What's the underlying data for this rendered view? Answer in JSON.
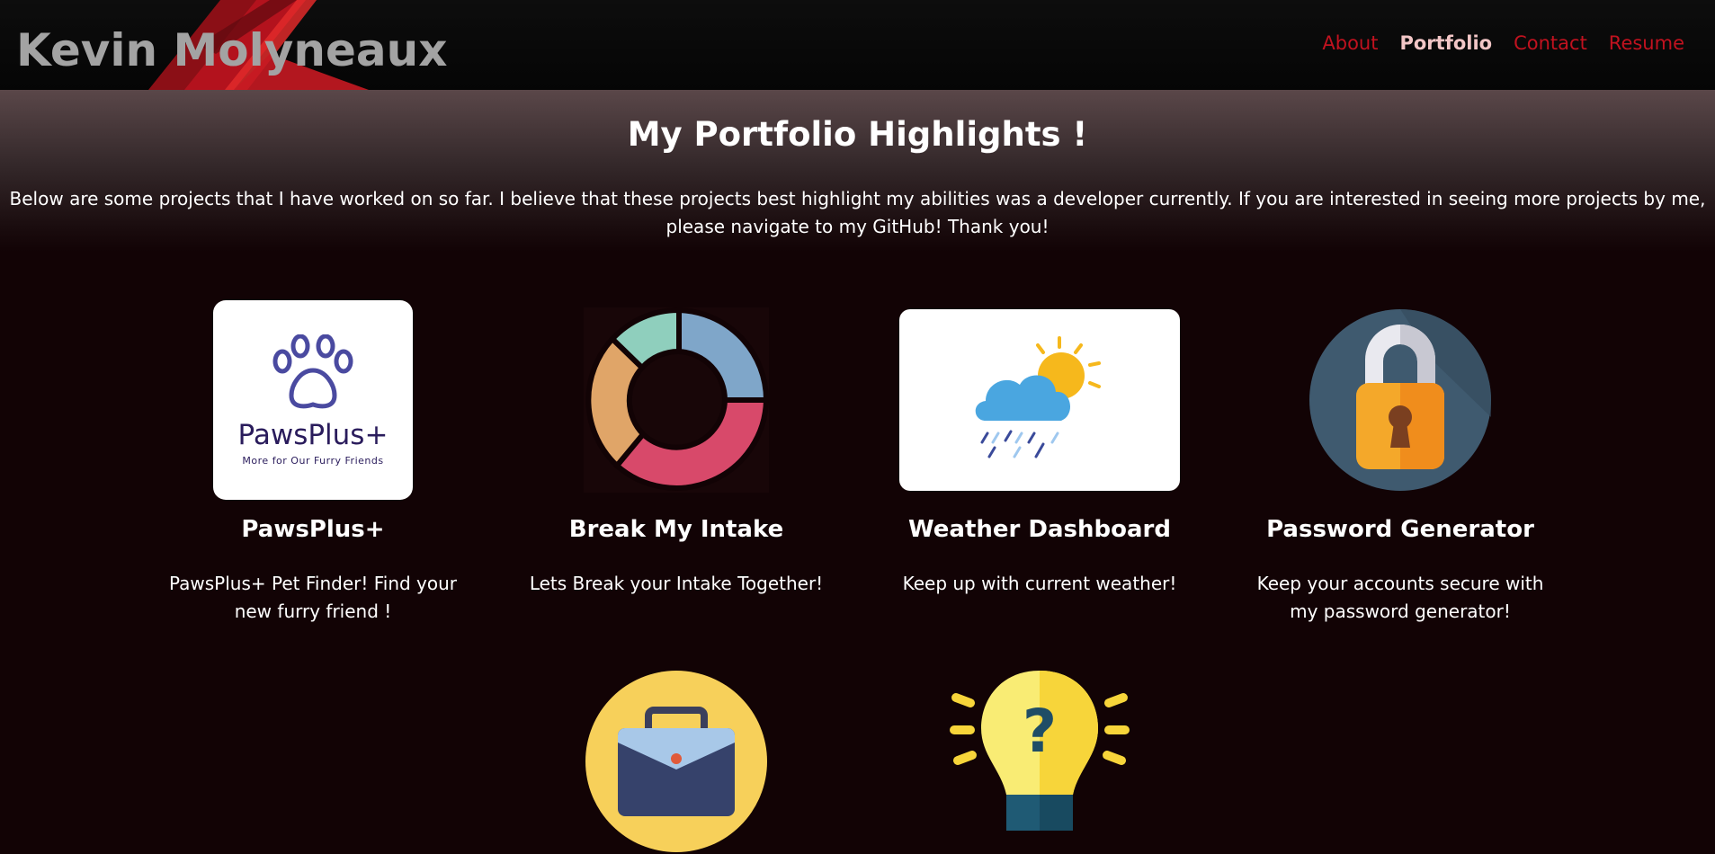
{
  "header": {
    "site_name": "Kevin Molyneaux",
    "nav": [
      "About",
      "Portfolio",
      "Contact",
      "Resume"
    ],
    "active_nav": "Portfolio"
  },
  "intro": {
    "title": "My Portfolio Highlights !",
    "text": "Below are some projects that I have worked on so far. I believe that these projects best highlight my abilities was a developer currently. If you are interested in seeing more projects by me, please navigate to my GitHub! Thank you!"
  },
  "projects": [
    {
      "title": "PawsPlus+",
      "description": "PawsPlus+ Pet Finder! Find your new furry friend !",
      "icon": "paw-logo-icon",
      "logo_title": "PawsPlus+",
      "logo_subtitle": "More for Our Furry Friends"
    },
    {
      "title": "Break My Intake",
      "description": "Lets Break your Intake Together!",
      "icon": "donut-chart-icon"
    },
    {
      "title": "Weather Dashboard",
      "description": "Keep up with current weather!",
      "icon": "weather-icon"
    },
    {
      "title": "Password Generator",
      "description": "Keep your accounts secure with my password generator!",
      "icon": "padlock-icon"
    },
    {
      "icon": "briefcase-icon"
    },
    {
      "icon": "lightbulb-question-icon"
    }
  ],
  "colors": {
    "background": "#120305",
    "nav_link": "#c1121f",
    "nav_active": "#f2c6c6",
    "site_name": "#a3a3a3"
  }
}
